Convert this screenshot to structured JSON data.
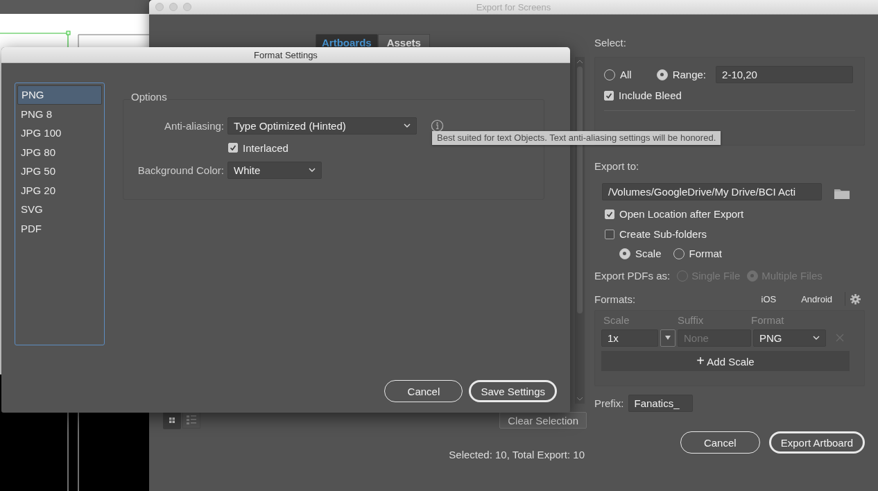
{
  "export_window": {
    "title": "Export for Screens",
    "tabs": [
      {
        "label": "Artboards",
        "selected": true
      },
      {
        "label": "Assets",
        "selected": false
      }
    ],
    "view_toggles": [
      {
        "selected": true
      },
      {
        "selected": false
      }
    ],
    "clear_selection_button": "Clear Selection",
    "summary": "Selected: 10, Total Export: 10",
    "select": {
      "label": "Select:",
      "options": [
        {
          "label": "All",
          "selected": false
        },
        {
          "label": "Range:",
          "selected": true
        }
      ],
      "range_value": "2-10,20",
      "include_bleed": {
        "label": "Include Bleed",
        "checked": true
      }
    },
    "export_to": {
      "label": "Export to:",
      "path": "/Volumes/GoogleDrive/My Drive/BCI Acti",
      "options": [
        {
          "label": "Open Location after Export",
          "checked": true
        },
        {
          "label": "Create Sub-folders",
          "checked": false
        }
      ],
      "subfolder_by": [
        {
          "label": "Scale",
          "selected": true
        },
        {
          "label": "Format",
          "selected": false
        }
      ]
    },
    "export_pdfs": {
      "label": "Export PDFs as:",
      "disabled": true,
      "options": [
        {
          "label": "Single File",
          "selected": false
        },
        {
          "label": "Multiple Files",
          "selected": true
        }
      ]
    },
    "formats": {
      "label": "Formats:",
      "presets": [
        "iOS",
        "Android"
      ],
      "columns": [
        "Scale",
        "Suffix",
        "Format"
      ],
      "rows": [
        {
          "scale": "1x",
          "suffix_placeholder": "None",
          "format": "PNG"
        }
      ],
      "add_icon": "+",
      "add_button": "Add Scale"
    },
    "prefix": {
      "label": "Prefix:",
      "value": "Fanatics_"
    },
    "buttons": [
      {
        "label": "Cancel",
        "default": false
      },
      {
        "label": "Export Artboard",
        "default": true
      }
    ]
  },
  "format_dialog": {
    "title": "Format Settings",
    "formats": [
      {
        "label": "PNG",
        "selected": true
      },
      {
        "label": "PNG 8",
        "selected": false
      },
      {
        "label": "JPG 100",
        "selected": false
      },
      {
        "label": "JPG 80",
        "selected": false
      },
      {
        "label": "JPG 50",
        "selected": false
      },
      {
        "label": "JPG 20",
        "selected": false
      },
      {
        "label": "SVG",
        "selected": false
      },
      {
        "label": "PDF",
        "selected": false
      }
    ],
    "options_legend": "Options",
    "anti_aliasing": {
      "label": "Anti-aliasing:",
      "value": "Type Optimized (Hinted)"
    },
    "interlaced": {
      "label": "Interlaced",
      "checked": true
    },
    "background_color": {
      "label": "Background Color:",
      "value": "White"
    },
    "buttons": [
      {
        "label": "Cancel",
        "default": false
      },
      {
        "label": "Save Settings",
        "default": true
      }
    ]
  },
  "tooltip": "Best suited for text Objects. Text anti-aliasing settings will be honored."
}
